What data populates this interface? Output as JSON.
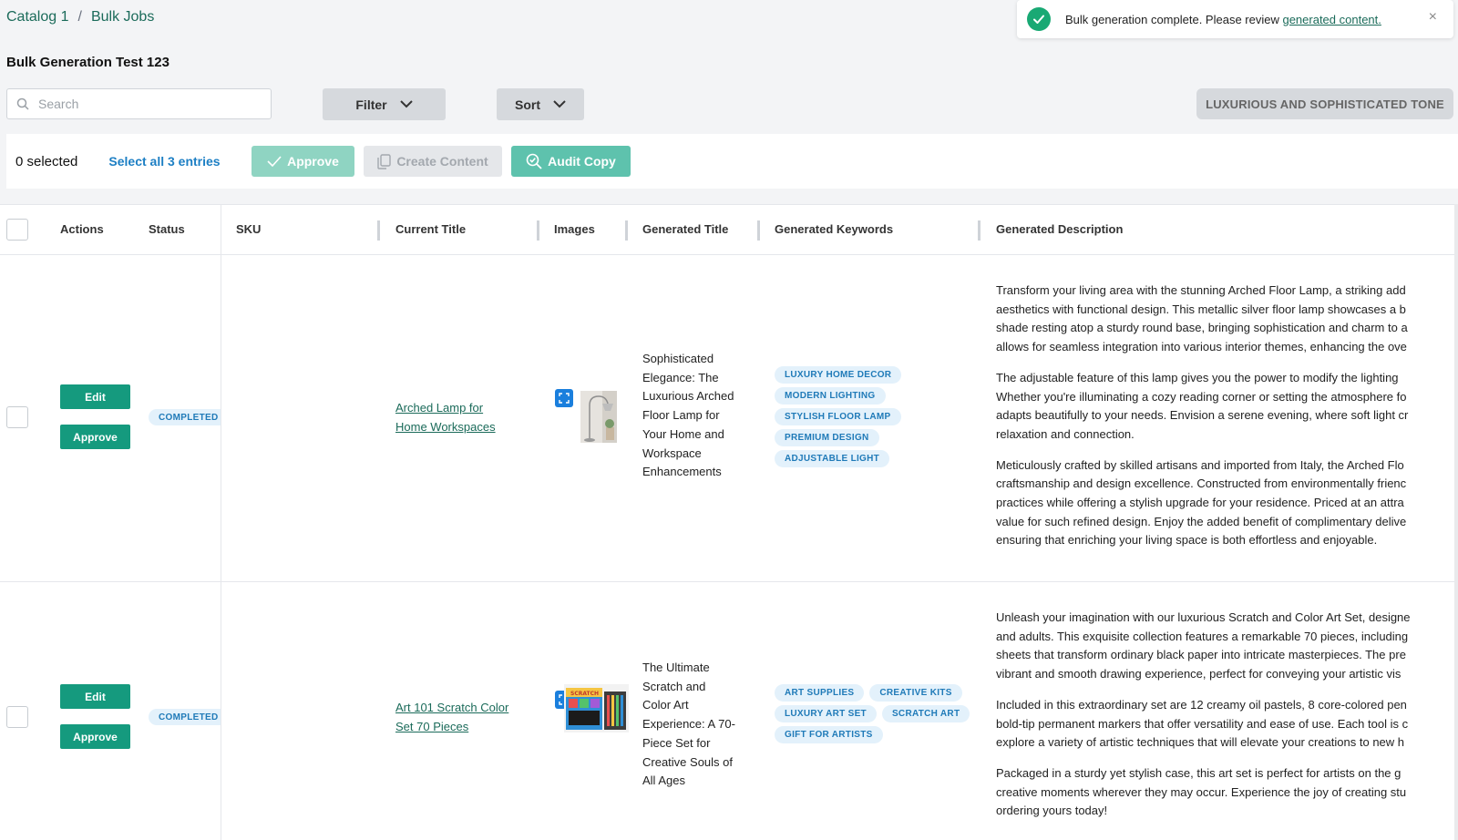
{
  "breadcrumb": {
    "items": [
      "Catalog 1",
      "Bulk Jobs"
    ],
    "separator": "/"
  },
  "page_title": "Bulk Generation Test 123",
  "toast": {
    "message": "Bulk generation complete. Please review ",
    "link": "generated content.",
    "close": "×"
  },
  "search": {
    "placeholder": "Search",
    "value": ""
  },
  "filter_label": "Filter",
  "sort_label": "Sort",
  "tone_label": "LUXURIOUS AND SOPHISTICATED TONE",
  "action_bar": {
    "selected": "0 selected",
    "select_all": "Select all 3 entries",
    "approve": "Approve",
    "create_content": "Create Content",
    "audit_copy": "Audit Copy"
  },
  "columns": [
    "Actions",
    "Status",
    "SKU",
    "Current Title",
    "Images",
    "Generated Title",
    "Generated Keywords",
    "Generated Description"
  ],
  "rows": [
    {
      "edit": "Edit",
      "approve": "Approve",
      "status": "COMPLETED",
      "sku": "",
      "current_title_lines": [
        "Arched Lamp for",
        "Home Workspaces"
      ],
      "generated_title_lines": [
        "Sophisticated",
        "Elegance: The",
        "Luxurious Arched",
        "Floor Lamp for",
        "Your Home and",
        "Workspace",
        "Enhancements"
      ],
      "keywords": [
        "LUXURY HOME DECOR",
        "MODERN LIGHTING",
        "STYLISH FLOOR LAMP",
        "PREMIUM DESIGN",
        "ADJUSTABLE LIGHT"
      ],
      "description": [
        [
          "Transform your living area with the stunning Arched Floor Lamp, a striking add",
          "aesthetics with functional design. This metallic silver floor lamp showcases a b",
          "shade resting atop a sturdy round base, bringing sophistication and charm to a",
          "allows for seamless integration into various interior themes, enhancing the ove"
        ],
        [
          "The adjustable feature of this lamp gives you the power to modify the lighting",
          "Whether you're illuminating a cozy reading corner or setting the atmosphere fo",
          "adapts beautifully to your needs. Envision a serene evening, where soft light cr",
          "relaxation and connection."
        ],
        [
          "Meticulously crafted by skilled artisans and imported from Italy, the Arched Flo",
          "craftsmanship and design excellence. Constructed from environmentally frienc",
          "practices while offering a stylish upgrade for your residence. Priced at an attra",
          "value for such refined design. Enjoy the added benefit of complimentary delive",
          "ensuring that enriching your living space is both effortless and enjoyable."
        ]
      ]
    },
    {
      "edit": "Edit",
      "approve": "Approve",
      "status": "COMPLETED",
      "sku": "",
      "current_title_lines": [
        "Art 101 Scratch Color",
        "Set 70 Pieces"
      ],
      "generated_title_lines": [
        "The Ultimate",
        "Scratch and",
        "Color Art",
        "Experience: A 70-",
        "Piece Set for",
        "Creative Souls of",
        "All Ages"
      ],
      "keywords": [
        "ART SUPPLIES",
        "CREATIVE KITS",
        "LUXURY ART SET",
        "SCRATCH ART",
        "GIFT FOR ARTISTS"
      ],
      "description": [
        [
          "Unleash your imagination with our luxurious Scratch and Color Art Set, designe",
          "and adults. This exquisite collection features a remarkable 70 pieces, including",
          "sheets that transform ordinary black paper into intricate masterpieces. The pre",
          "vibrant and smooth drawing experience, perfect for conveying your artistic vis"
        ],
        [
          "Included in this extraordinary set are 12 creamy oil pastels, 8 core-colored pen",
          "bold-tip permanent markers that offer versatility and ease of use. Each tool is c",
          "explore a variety of artistic techniques that will elevate your creations to new h"
        ],
        [
          "Packaged in a sturdy yet stylish case, this art set is perfect for artists on the g",
          "creative moments wherever they may occur. Experience the joy of creating stu",
          "ordering yours today!"
        ]
      ]
    }
  ],
  "thumb_text": "SCRATCH",
  "colors": {
    "accent": "#159a7e",
    "link": "#1b6b5a",
    "badge_bg": "#e3f1fb",
    "badge_text": "#1f7ab8"
  }
}
